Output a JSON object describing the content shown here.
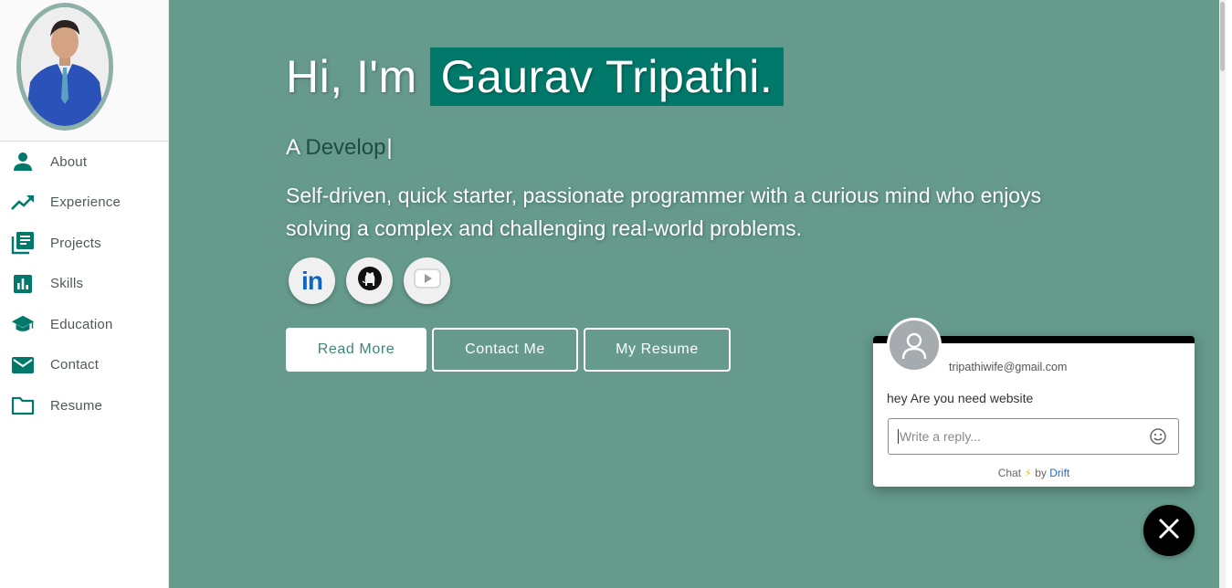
{
  "sidebar": {
    "items": [
      {
        "label": "About",
        "icon": "person-icon"
      },
      {
        "label": "Experience",
        "icon": "trending-up-icon"
      },
      {
        "label": "Projects",
        "icon": "library-books-icon"
      },
      {
        "label": "Skills",
        "icon": "bar-chart-icon"
      },
      {
        "label": "Education",
        "icon": "school-icon"
      },
      {
        "label": "Contact",
        "icon": "mail-icon"
      },
      {
        "label": "Resume",
        "icon": "folder-icon"
      }
    ]
  },
  "hero": {
    "greeting": "Hi, I'm",
    "name": "Gaurav Tripathi.",
    "subtitle_prefix": "A ",
    "subtitle_typed": "Develop",
    "cursor": "|",
    "description": "Self-driven, quick starter, passionate programmer with a curious mind who enjoys solving a complex and challenging real-world problems."
  },
  "social": [
    {
      "name": "linkedin",
      "label": "in"
    },
    {
      "name": "github"
    },
    {
      "name": "youtube"
    }
  ],
  "buttons": {
    "read_more": "Read More",
    "contact_me": "Contact Me",
    "my_resume": "My Resume"
  },
  "chat": {
    "sender": "tripathiwife@gmail.com",
    "message": "hey Are you need website",
    "placeholder": "Write a reply...",
    "footer_chat": "Chat",
    "footer_by": "by",
    "footer_brand": "Drift"
  },
  "colors": {
    "main_bg": "#659a8d",
    "accent": "#00796b",
    "sidebar_icon": "#00796b"
  }
}
